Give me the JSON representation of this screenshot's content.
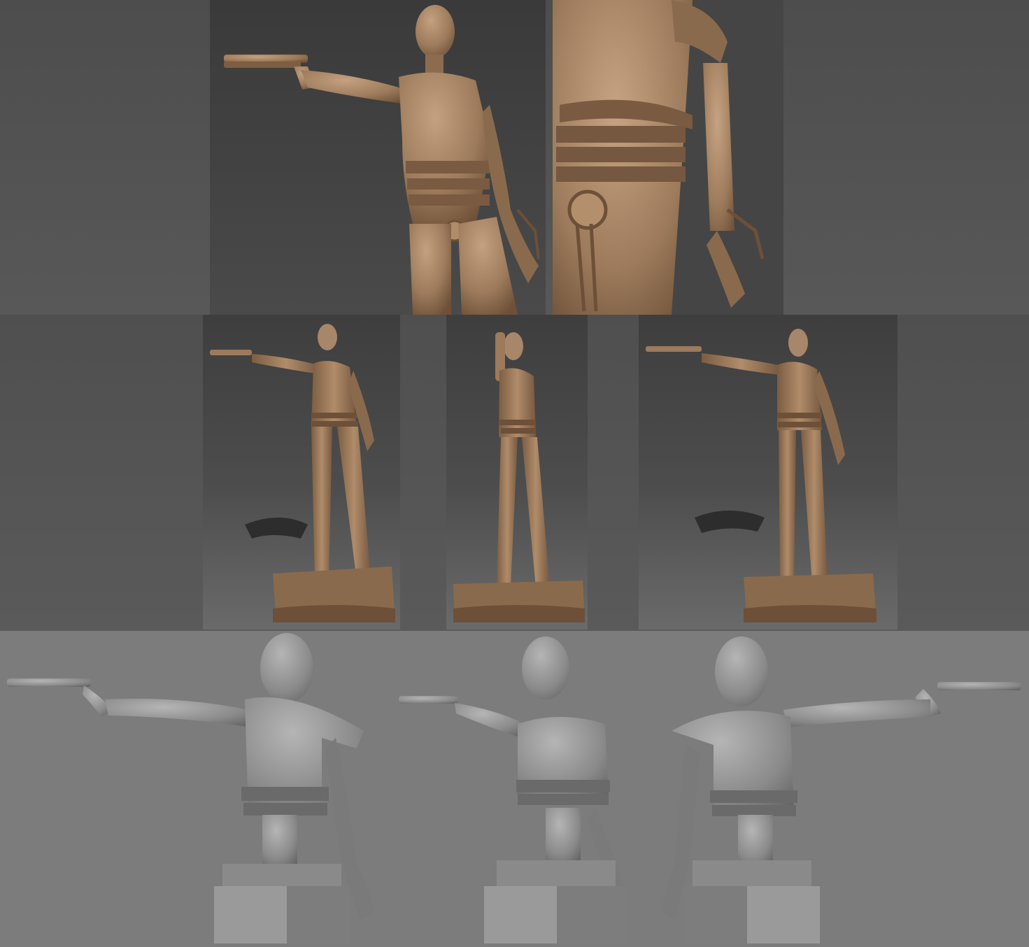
{
  "sheet": {
    "colors": {
      "clay": "#9c7a5b",
      "clay_dark": "#6d5037",
      "clay_light": "#c4a17f",
      "background_dark": "#4d4d4d",
      "background_gray": "#7c7c7c",
      "gray_model": "#9a9a9a",
      "gray_model_dark": "#5e5e5e"
    },
    "rows": [
      {
        "id": "top",
        "panels": [
          "closeup-front-three-quarter",
          "closeup-torso-arm"
        ]
      },
      {
        "id": "middle",
        "panels": [
          "full-figure-front",
          "full-figure-side",
          "full-figure-three-quarter"
        ]
      },
      {
        "id": "bottom",
        "panels": [
          "bust-left",
          "bust-front",
          "bust-back"
        ]
      }
    ]
  }
}
